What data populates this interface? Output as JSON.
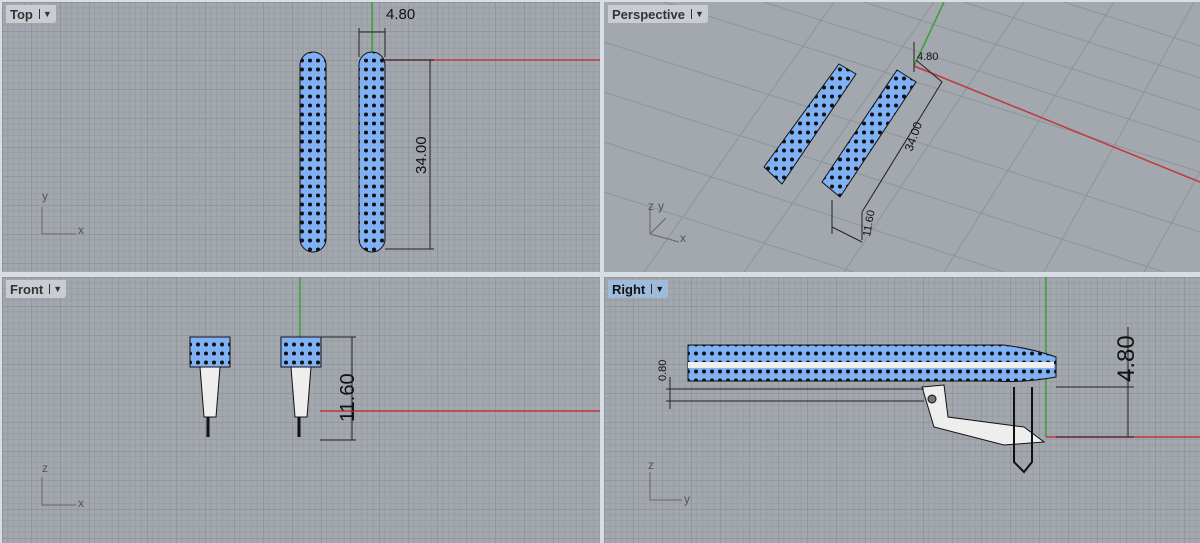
{
  "viewports": {
    "top": {
      "label": "Top",
      "dims": [
        "4.80",
        "34.00"
      ],
      "axes": [
        "y",
        "x"
      ]
    },
    "perspective": {
      "label": "Perspective",
      "dims": [
        "4.80",
        "34.00",
        "11.60"
      ],
      "axes": [
        "z",
        "y",
        "x"
      ]
    },
    "front": {
      "label": "Front",
      "dims": [
        "11.60"
      ],
      "axes": [
        "z",
        "x"
      ]
    },
    "right": {
      "label": "Right",
      "dims": [
        "4.80",
        "0.80"
      ],
      "axes": [
        "z",
        "y"
      ],
      "active": true
    }
  },
  "colors": {
    "x_axis": "#c0393b",
    "y_axis": "#3aa03a",
    "object": "#7fb0f5",
    "active_label": "#9ebbdc"
  },
  "dropdown_icon": "triangle-down"
}
